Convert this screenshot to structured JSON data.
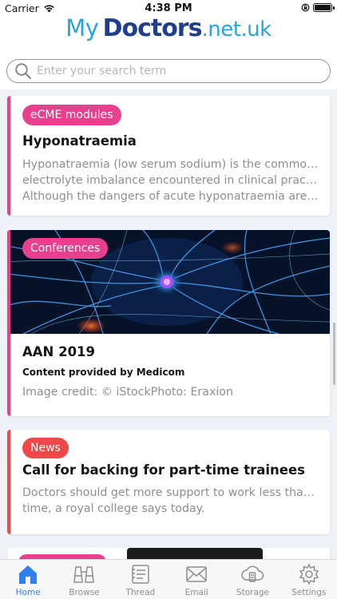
{
  "status_bar": {
    "carrier": "Carrier",
    "time": "4:38 PM",
    "wifi_icon": "wifi-icon",
    "battery_icon": "battery-full-icon"
  },
  "logo": {
    "my": "My",
    "doctors": "Doctors",
    "net": ".net.uk",
    "colors": {
      "light": "#29a3d8",
      "dark": "#1f3f8a"
    }
  },
  "search": {
    "placeholder": "Enter your search term",
    "value": "",
    "icon": "search-icon"
  },
  "feed": {
    "cards": [
      {
        "category": "eCME modules",
        "category_color": "#e8408f",
        "title": "Hyponatraemia",
        "excerpt_lines": [
          "Hyponatraemia (low serum sodium) is the commonest",
          "electrolyte imbalance encountered in clinical practice.",
          "Although the dangers of acute hyponatraemia are w…"
        ]
      },
      {
        "category": "Conferences",
        "category_color": "#e8408f",
        "title": "AAN 2019",
        "provider": "Content provided by Medicom",
        "credit": "Image credit: © iStockPhoto: Eraxion",
        "image": "neuron-illustration"
      },
      {
        "category": "News",
        "category_color": "#f04848",
        "title": "Call for backing for part-time trainees",
        "excerpt_lines": [
          "Doctors should get more support to work less than full",
          "time, a royal college says today."
        ]
      }
    ]
  },
  "tabbar": {
    "active_color": "#2f80ed",
    "items": [
      {
        "label": "Home",
        "icon": "home-icon",
        "active": true
      },
      {
        "label": "Browse",
        "icon": "binoculars-icon",
        "active": false
      },
      {
        "label": "Thread",
        "icon": "thread-icon",
        "active": false
      },
      {
        "label": "Email",
        "icon": "email-icon",
        "active": false
      },
      {
        "label": "Storage",
        "icon": "storage-icon",
        "active": false
      },
      {
        "label": "Settings",
        "icon": "gear-icon",
        "active": false
      }
    ]
  }
}
